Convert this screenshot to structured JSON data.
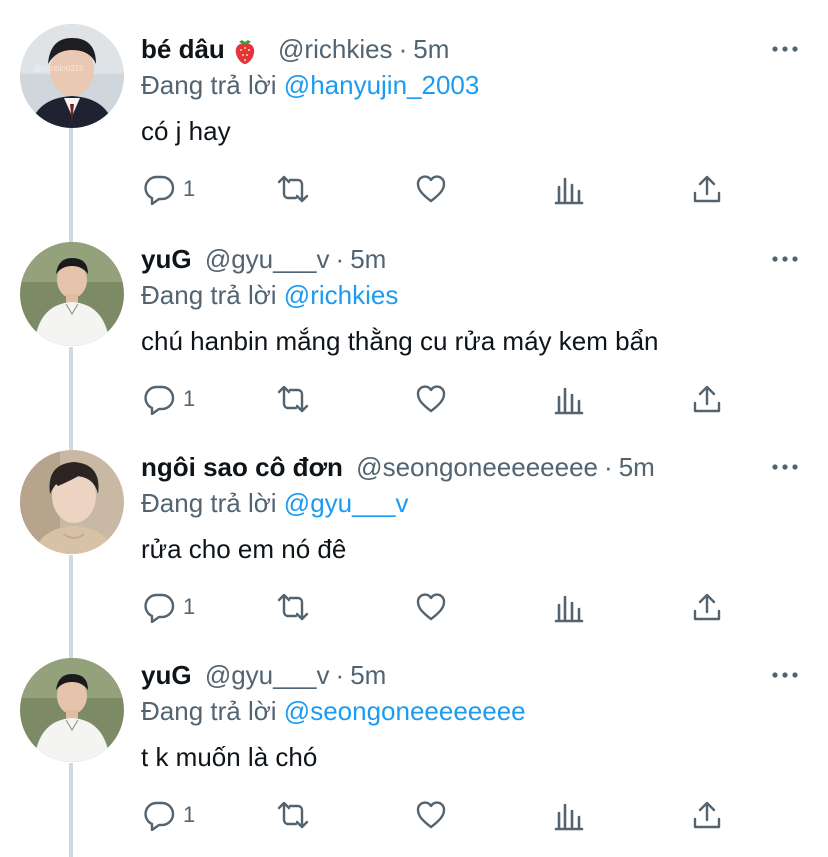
{
  "reply_prefix": "Đang trả lời",
  "tweets": [
    {
      "name": "bé dâu",
      "name_emoji": "strawberry-icon",
      "handle": "@richkies",
      "time": "5m",
      "reply_to": "@hanyujin_2003",
      "text": "có j hay",
      "reply_count": "1",
      "avatar_watermark": "@sunbin0315"
    },
    {
      "name": "yuG",
      "handle": "@gyu___v",
      "time": "5m",
      "reply_to": "@richkies",
      "text": "chú hanbin mắng thằng cu rửa máy kem bẩn",
      "reply_count": "1"
    },
    {
      "name": "ngôi sao cô đơn",
      "handle": "@seongoneeeeeeee",
      "time": "5m",
      "reply_to": "@gyu___v",
      "text": "rửa cho em nó đê",
      "reply_count": "1"
    },
    {
      "name": "yuG",
      "handle": "@gyu___v",
      "time": "5m",
      "reply_to": "@seongoneeeeeeee",
      "text": "t k muốn là chó",
      "reply_count": "1"
    }
  ],
  "separator": "·",
  "colors": {
    "accent": "#1d9bf0",
    "secondary": "#536471",
    "thread_line": "#cfd9de"
  }
}
